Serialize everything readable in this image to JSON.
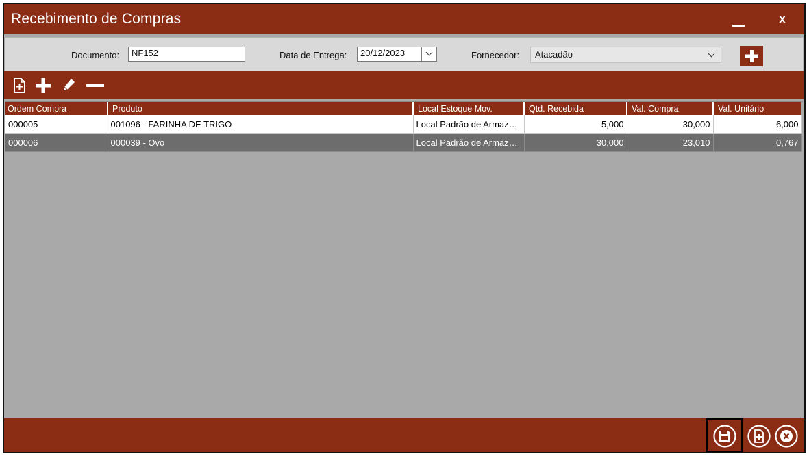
{
  "window": {
    "title": "Recebimento de Compras",
    "close_label": "x"
  },
  "filters": {
    "documento_label": "Documento:",
    "documento_value": "NF152",
    "data_label": "Data de Entrega:",
    "data_value": "20/12/2023",
    "fornecedor_label": "Fornecedor:",
    "fornecedor_value": "Atacadão"
  },
  "toolbar": {
    "icons": [
      "new-document-icon",
      "plus-icon",
      "pencil-icon",
      "minus-icon"
    ]
  },
  "grid": {
    "columns": [
      "Ordem Compra",
      "Produto",
      "Local Estoque Mov.",
      "Qtd. Recebida",
      "Val. Compra",
      "Val. Unitário"
    ],
    "rows": [
      [
        "000005",
        "001096 - FARINHA DE TRIGO",
        "Local Padrão de Armazenamento",
        "5,000",
        "30,000",
        "6,000"
      ],
      [
        "000006",
        "000039 - Ovo",
        "Local Padrão de Armazenamento",
        "30,000",
        "23,010",
        "0,767"
      ]
    ]
  },
  "bottom": {
    "icons": [
      "save-icon",
      "new-document-icon",
      "cancel-icon"
    ]
  },
  "colors": {
    "accent": "#8b2c14",
    "panel": "#d9d9d9",
    "grid_bg": "#a9a9a9",
    "selected_row": "#6d6d6d"
  }
}
